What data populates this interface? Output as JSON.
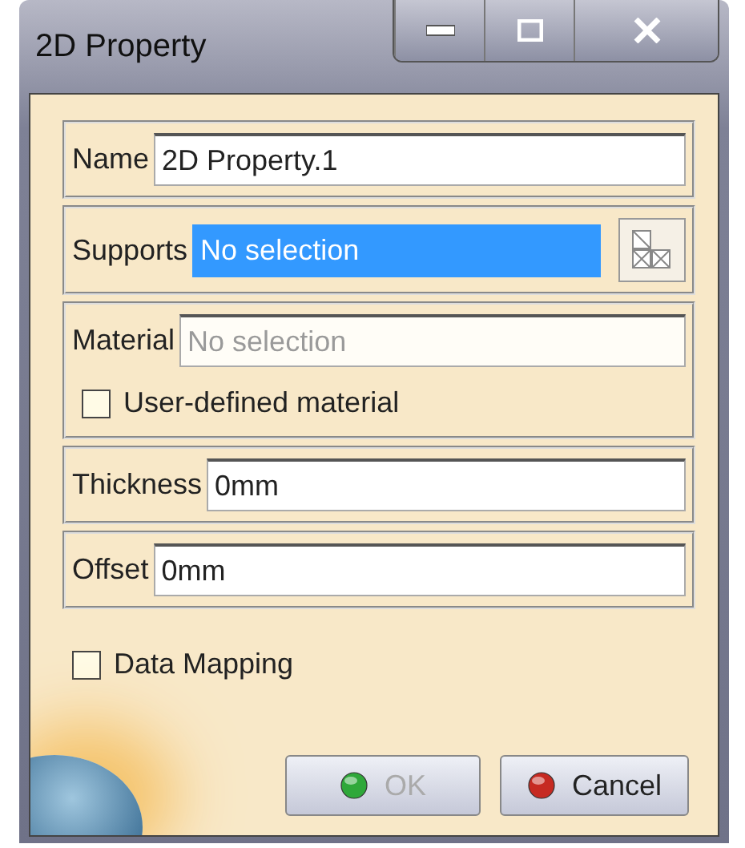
{
  "window": {
    "title": "2D Property"
  },
  "groups": [
    {
      "fields": [
        {
          "label": "Name",
          "value": "2D Property.1",
          "kind": "text",
          "selected": false,
          "disabled": false
        }
      ]
    },
    {
      "fields": [
        {
          "label": "Supports",
          "value": "No selection",
          "kind": "picker",
          "selected": true,
          "disabled": false
        }
      ]
    },
    {
      "fields": [
        {
          "label": "Material",
          "value": "No selection",
          "kind": "text",
          "selected": false,
          "disabled": true
        }
      ],
      "checkbox": {
        "label": "User-defined material",
        "checked": false
      }
    },
    {
      "fields": [
        {
          "label": "Thickness",
          "value": "0mm",
          "kind": "text",
          "selected": false,
          "disabled": false
        }
      ]
    },
    {
      "fields": [
        {
          "label": "Offset",
          "value": "0mm",
          "kind": "text",
          "selected": false,
          "disabled": false
        }
      ]
    }
  ],
  "data_mapping": {
    "label": "Data Mapping",
    "checked": false
  },
  "buttons": [
    {
      "label": "OK",
      "kind": "ok",
      "disabled": true
    },
    {
      "label": "Cancel",
      "kind": "cancel",
      "disabled": false
    }
  ]
}
